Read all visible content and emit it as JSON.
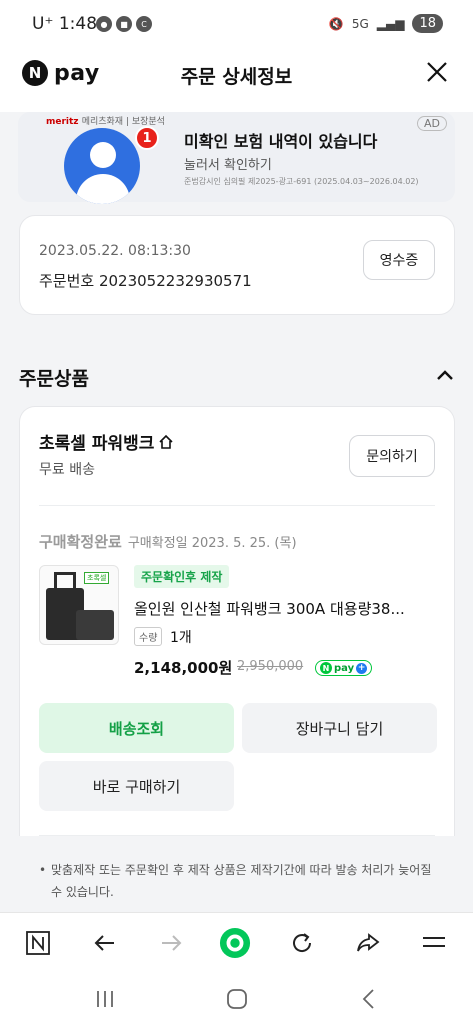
{
  "status_bar": {
    "carrier": "U⁺",
    "time": "1:48",
    "network": "5G",
    "battery": "18"
  },
  "header": {
    "logo_n": "N",
    "logo_text": "pay",
    "title": "주문 상세정보"
  },
  "ad": {
    "brand": "meritz",
    "brand_sub": "메리츠화재 | 보장분석",
    "badge": "1",
    "tag": "AD",
    "headline": "미확인 보험 내역이 있습니다",
    "sub": "눌러서 확인하기",
    "fine": "준법감시인 심의필 제2025-광고-691 (2025.04.03~2026.04.02)"
  },
  "order": {
    "datetime": "2023.05.22. 08:13:30",
    "number_label": "주문번호 2023052232930571",
    "receipt_button": "영수증"
  },
  "section": {
    "title": "주문상품"
  },
  "store": {
    "name": "초록셀 파워뱅크",
    "shipping": "무료 배송",
    "inquiry_button": "문의하기"
  },
  "item": {
    "status": "구매확정완료",
    "confirm_date": "구매확정일 2023. 5. 25. (목)",
    "thumb_label": "초록셀",
    "tag": "주문확인후 제작",
    "name": "올인원 인산철 파워뱅크 300A 대용량38...",
    "qty_label": "수량",
    "qty": "1개",
    "price": "2,148,000원",
    "original_price": "2,950,000",
    "npay_badge": "pay"
  },
  "buttons": {
    "track": "배송조회",
    "cart": "장바구니 담기",
    "buy_again": "바로 구매하기"
  },
  "notice": "맞춤제작 또는 주문확인 후 제작 상품은 제작기간에 따라 발송 처리가 늦어질 수 있습니다."
}
